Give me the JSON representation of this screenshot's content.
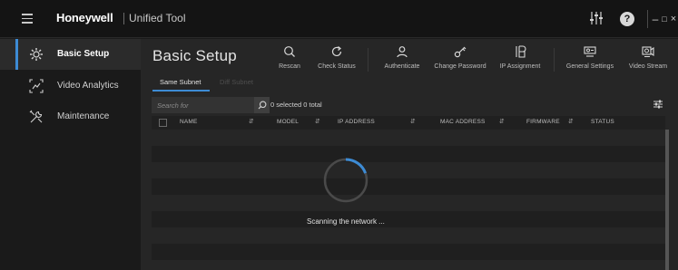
{
  "titlebar": {
    "brand": "Honeywell",
    "product": "Unified Tool",
    "icons": [
      "hamburger-icon",
      "mixer-icon",
      "help-icon",
      "minimize-icon",
      "maximize-icon",
      "close-icon"
    ],
    "help_glyph": "?",
    "min_glyph": "–",
    "max_glyph": "□",
    "close_glyph": "×"
  },
  "sidebar": {
    "items": [
      {
        "label": "Basic Setup",
        "icon": "gear-icon",
        "active": true
      },
      {
        "label": "Video Analytics",
        "icon": "analytics-icon",
        "active": false
      },
      {
        "label": "Maintenance",
        "icon": "tools-icon",
        "active": false
      }
    ]
  },
  "main": {
    "title": "Basic Setup",
    "toolbar": [
      {
        "label": "Rescan",
        "icon": "search-icon"
      },
      {
        "label": "Check Status",
        "icon": "refresh-icon"
      },
      {
        "label": "Authenticate",
        "icon": "user-icon"
      },
      {
        "label": "Change Password",
        "icon": "key-icon"
      },
      {
        "label": "IP Assignment",
        "icon": "ip-icon"
      },
      {
        "label": "General Settings",
        "icon": "settings-icon"
      },
      {
        "label": "Video Stream",
        "icon": "camera-icon"
      }
    ],
    "subtabs": [
      {
        "label": "Same Subnet",
        "active": true
      },
      {
        "label": "Diff Subnet",
        "active": false
      }
    ],
    "search": {
      "placeholder": "Search for",
      "value": ""
    },
    "selection": "0 selected  0 total",
    "table": {
      "columns": [
        "NAME",
        "MODEL",
        "IP ADDRESS",
        "MAC ADDRESS",
        "FIRMWARE",
        "STATUS"
      ],
      "rows": []
    },
    "status_message": "Scanning the network ..."
  },
  "colors": {
    "accent": "#3d8bd4",
    "background": "#1b1b1b",
    "panel": "#262626",
    "text": "#d8d8d8"
  }
}
